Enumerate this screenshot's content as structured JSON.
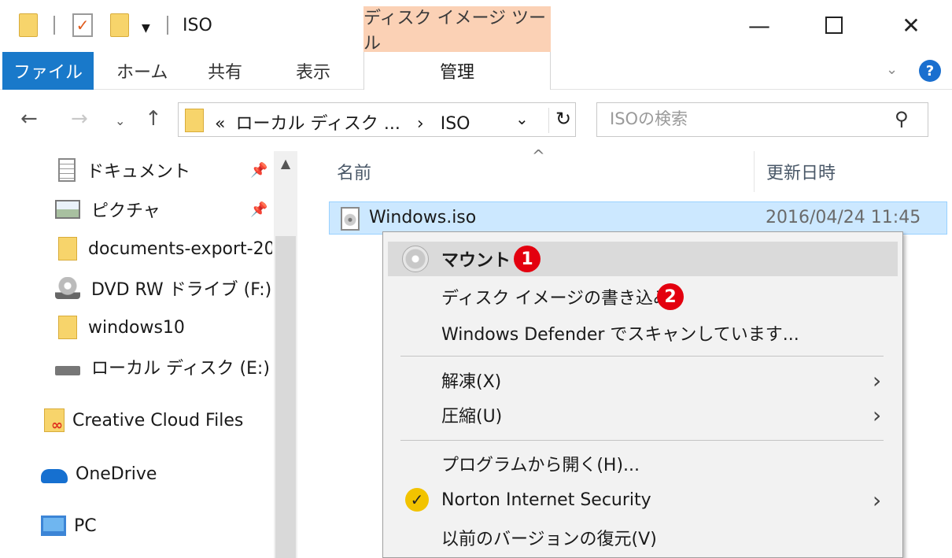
{
  "titlebar": {
    "title": "ISO",
    "context_tab_group": "ディスク イメージ ツール",
    "minimize": "—",
    "close": "✕"
  },
  "ribbon": {
    "tabs": [
      "ファイル",
      "ホーム",
      "共有",
      "表示",
      "管理"
    ],
    "help": "?"
  },
  "address": {
    "breadcrumb_prefix": "«",
    "breadcrumb_parent": "ローカル ディスク ...",
    "breadcrumb_sep": "›",
    "breadcrumb_current": "ISO",
    "search_placeholder": "ISOの検索"
  },
  "navpane": {
    "items": [
      {
        "label": "ドキュメント",
        "icon": "document-icon",
        "pinned": true
      },
      {
        "label": "ピクチャ",
        "icon": "pictures-icon",
        "pinned": true
      },
      {
        "label": "documents-export-20",
        "icon": "folder-icon"
      },
      {
        "label": "DVD RW ドライブ (F:)",
        "icon": "dvd-drive-icon"
      },
      {
        "label": "windows10",
        "icon": "folder-icon"
      },
      {
        "label": "ローカル ディスク (E:)",
        "icon": "disk-drive-icon"
      },
      {
        "label": "Creative Cloud Files",
        "icon": "creative-cloud-icon"
      },
      {
        "label": "OneDrive",
        "icon": "onedrive-icon"
      },
      {
        "label": "PC",
        "icon": "pc-icon"
      }
    ]
  },
  "filelist": {
    "columns": [
      "名前",
      "更新日時"
    ],
    "rows": [
      {
        "name": "Windows.iso",
        "modified": "2016/04/24 11:45"
      }
    ]
  },
  "context_menu": {
    "items": [
      {
        "label": "マウント",
        "badge": "1"
      },
      {
        "label": "ディスク イメージの書き込み",
        "badge": "2"
      },
      {
        "label": "Windows Defender でスキャンしています..."
      },
      {
        "label": "解凍(X)"
      },
      {
        "label": "圧縮(U)"
      },
      {
        "label": "プログラムから開く(H)..."
      },
      {
        "label": "Norton Internet Security"
      },
      {
        "label": "以前のバージョンの復元(V)"
      }
    ]
  },
  "colors": {
    "file_tab": "#1979ca",
    "context_tab": "#fbd1b5",
    "selection": "#cce8ff",
    "badge": "#e3000f"
  }
}
